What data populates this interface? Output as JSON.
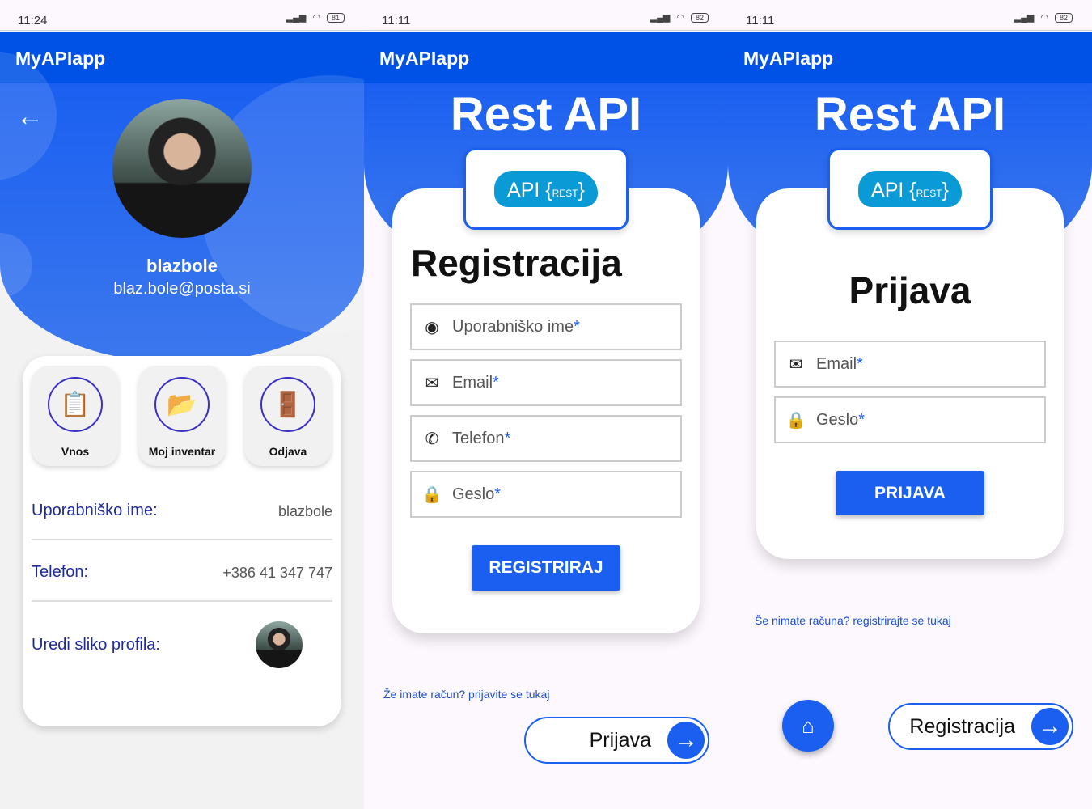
{
  "app_title": "MyAPIapp",
  "screens": [
    {
      "time": "11:24",
      "battery": "81"
    },
    {
      "time": "11:11",
      "battery": "82"
    },
    {
      "time": "11:11",
      "battery": "82"
    }
  ],
  "profile": {
    "username": "blazbole",
    "email": "blaz.bole@posta.si",
    "tiles": [
      {
        "label": "Vnos"
      },
      {
        "label": "Moj inventar"
      },
      {
        "label": "Odjava"
      }
    ],
    "rows": [
      {
        "label": "Uporabniško ime:",
        "value": "blazbole"
      },
      {
        "label": "Telefon:",
        "value": "+386 41 347 747"
      },
      {
        "label": "Uredi sliko profila:"
      }
    ]
  },
  "logo": {
    "api": "API",
    "rest": "REST"
  },
  "register": {
    "header": "Rest API",
    "title": "Registracija",
    "fields": [
      {
        "label": "Uporabniško ime"
      },
      {
        "label": "Email"
      },
      {
        "label": "Telefon"
      },
      {
        "label": "Geslo"
      }
    ],
    "required": "*",
    "submit": "REGISTRIRAJ",
    "link": "Že imate račun? prijavite se tukaj",
    "nav_button": "Prijava"
  },
  "login": {
    "header": "Rest API",
    "title": "Prijava",
    "fields": [
      {
        "label": "Email"
      },
      {
        "label": "Geslo"
      }
    ],
    "required": "*",
    "submit": "PRIJAVA",
    "link": "Še nimate računa? registrirajte se tukaj",
    "nav_button": "Registracija"
  },
  "colors": {
    "primary": "#1a5ff0",
    "appbar": "#0052e6"
  }
}
